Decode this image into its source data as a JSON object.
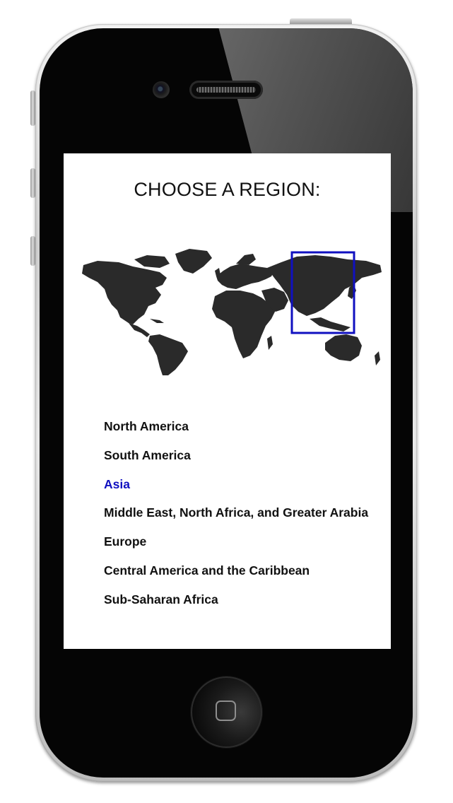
{
  "screen": {
    "title": "CHOOSE A REGION:",
    "map": {
      "highlight_region": "Asia",
      "highlight_color": "#1010c0"
    },
    "regions": [
      {
        "label": "North America",
        "selected": false
      },
      {
        "label": "South America",
        "selected": false
      },
      {
        "label": "Asia",
        "selected": true
      },
      {
        "label": "Middle East, North Africa, and Greater Arabia",
        "selected": false
      },
      {
        "label": "Europe",
        "selected": false
      },
      {
        "label": "Central America and the Caribbean",
        "selected": false
      },
      {
        "label": "Sub-Saharan Africa",
        "selected": false
      }
    ]
  },
  "device": {
    "home_button_icon": "square-icon",
    "camera_icon": "camera-icon",
    "speaker_icon": "speaker-grille-icon"
  },
  "colors": {
    "accent": "#1010c0",
    "text": "#111111",
    "map_land": "#2a2a2a"
  }
}
